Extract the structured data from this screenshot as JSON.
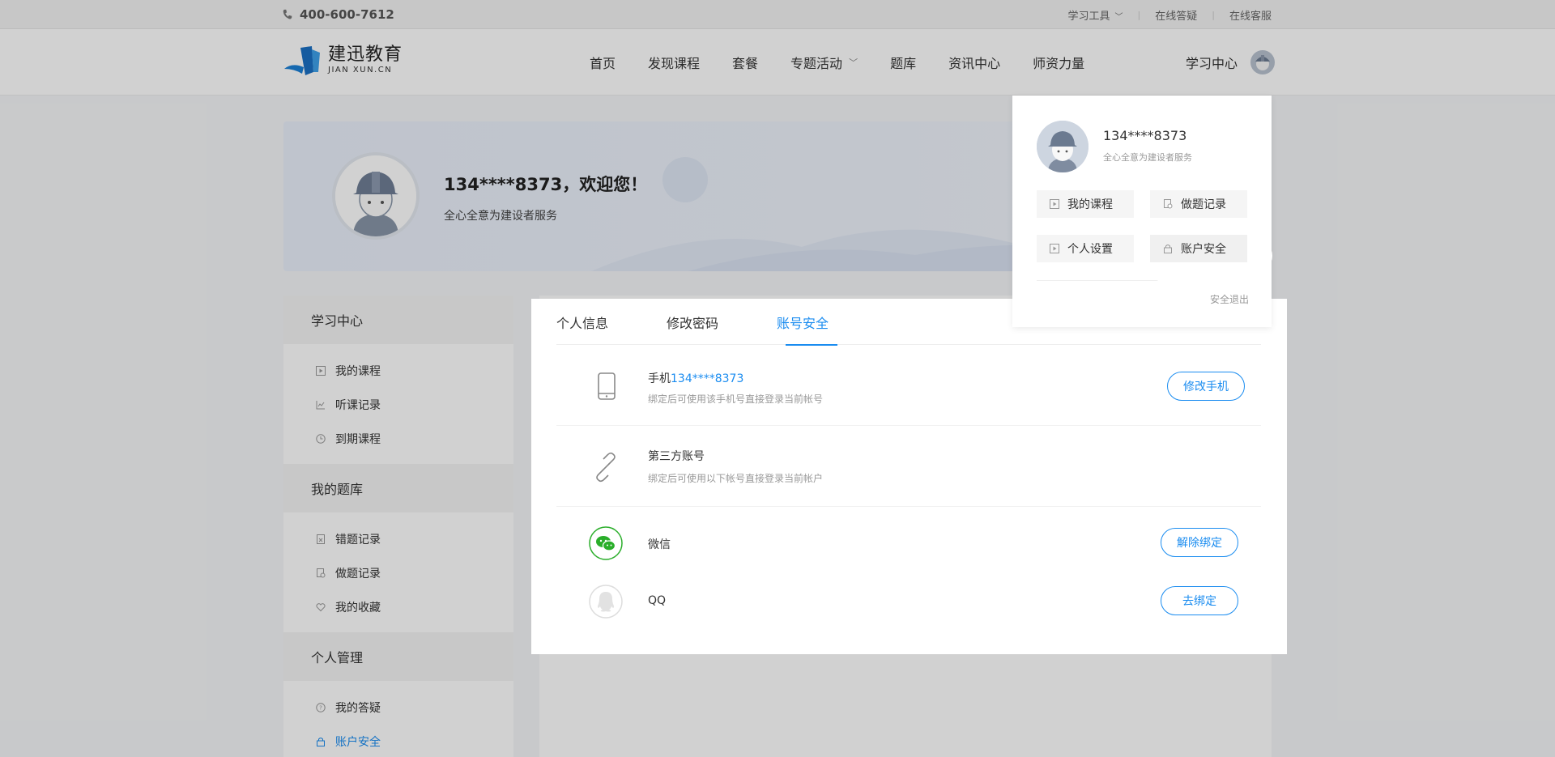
{
  "topbar": {
    "phone": "400-600-7612",
    "links": [
      "学习工具",
      "在线答疑",
      "在线客服"
    ]
  },
  "header": {
    "logo_cn": "建迅教育",
    "logo_en": "JIAN XUN.CN",
    "nav": [
      "首页",
      "发现课程",
      "套餐",
      "专题活动",
      "题库",
      "资讯中心",
      "师资力量"
    ],
    "user_center": "学习中心"
  },
  "banner": {
    "welcome": "134****8373，欢迎您！",
    "slogan": "全心全意为建设者服务"
  },
  "sidebar": {
    "sections": [
      {
        "title": "学习中心",
        "items": [
          "我的课程",
          "听课记录",
          "到期课程"
        ]
      },
      {
        "title": "我的题库",
        "items": [
          "错题记录",
          "做题记录",
          "我的收藏"
        ]
      },
      {
        "title": "个人管理",
        "items": [
          "我的答疑",
          "账户安全"
        ]
      }
    ]
  },
  "tabs": [
    "个人信息",
    "修改密码",
    "账号安全"
  ],
  "security": {
    "phone_label": "手机",
    "phone_value": "134****8373",
    "phone_desc": "绑定后可使用该手机号直接登录当前帐号",
    "phone_button": "修改手机",
    "third_label": "第三方账号",
    "third_desc": "绑定后可使用以下帐号直接登录当前帐户",
    "wechat_label": "微信",
    "wechat_button": "解除绑定",
    "qq_label": "QQ",
    "qq_button": "去绑定"
  },
  "dropdown": {
    "name": "134****8373",
    "slogan": "全心全意为建设者服务",
    "buttons": [
      "我的课程",
      "做题记录",
      "个人设置",
      "账户安全"
    ],
    "logout": "安全退出"
  },
  "colors": {
    "accent": "#1a8cf0",
    "wechat": "#2aae2a"
  }
}
